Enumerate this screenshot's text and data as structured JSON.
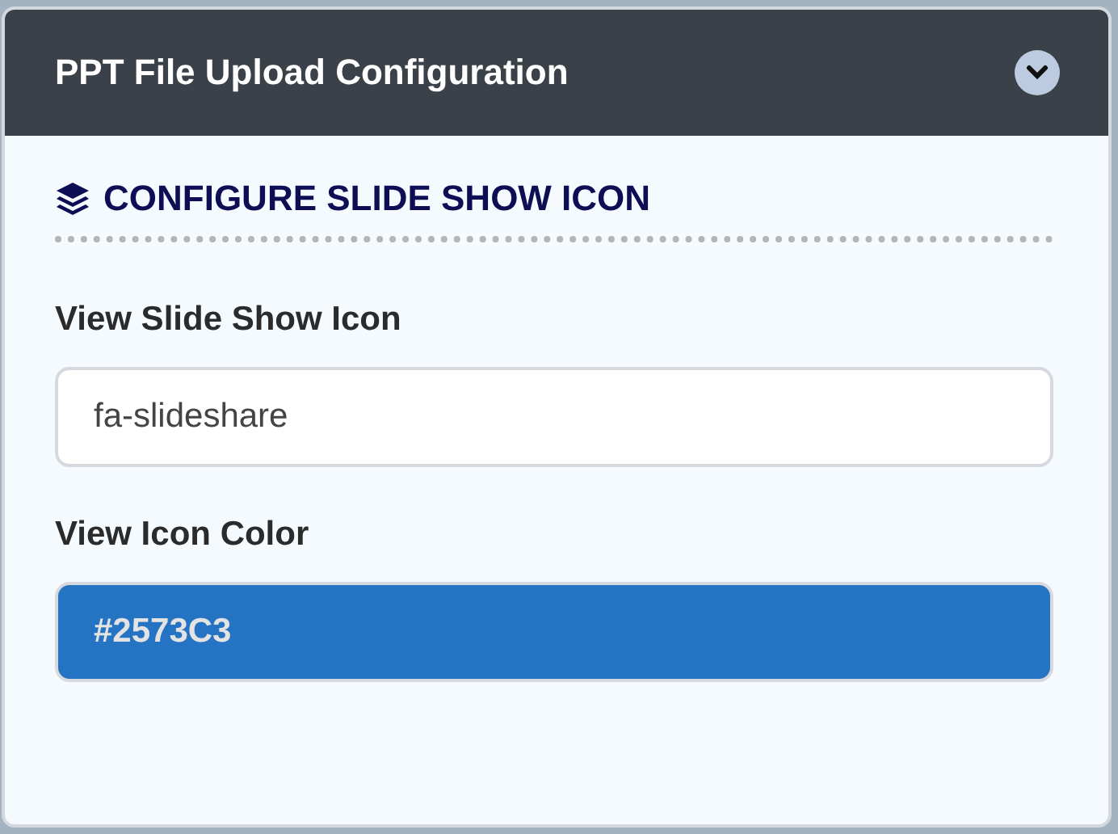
{
  "panel": {
    "title": "PPT File Upload Configuration",
    "expanded": true
  },
  "section": {
    "title": "CONFIGURE SLIDE SHOW ICON"
  },
  "fields": [
    {
      "kind": "text",
      "label": "View Slide Show Icon",
      "value": "fa-slideshare"
    },
    {
      "kind": "color",
      "label": "View Icon Color",
      "value": "#2573C3"
    }
  ]
}
